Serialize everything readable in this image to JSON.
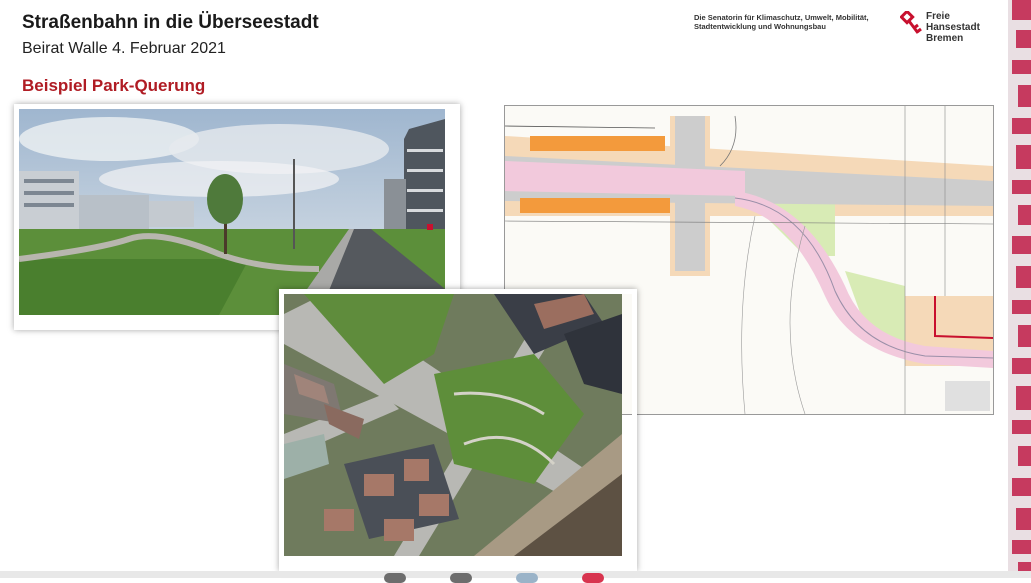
{
  "slide": {
    "title": "Straßenbahn in die Überseestadt",
    "subtitle": "Beirat Walle 4. Februar 2021",
    "section": "Beispiel Park-Querung"
  },
  "header": {
    "sender_line1": "Die Senatorin für Klimaschutz, Umwelt, Mobilität,",
    "sender_line2": "Stadtentwicklung und Wohnungsbau",
    "logo_line1": "Freie",
    "logo_line2": "Hansestadt",
    "logo_line3": "Bremen"
  },
  "colors": {
    "accent": "#b01c24",
    "plan_orange": "#f39a3c",
    "plan_pink": "#f2c9dc",
    "plan_green": "#d8ebb5",
    "plan_tan": "#f5d9b8"
  }
}
